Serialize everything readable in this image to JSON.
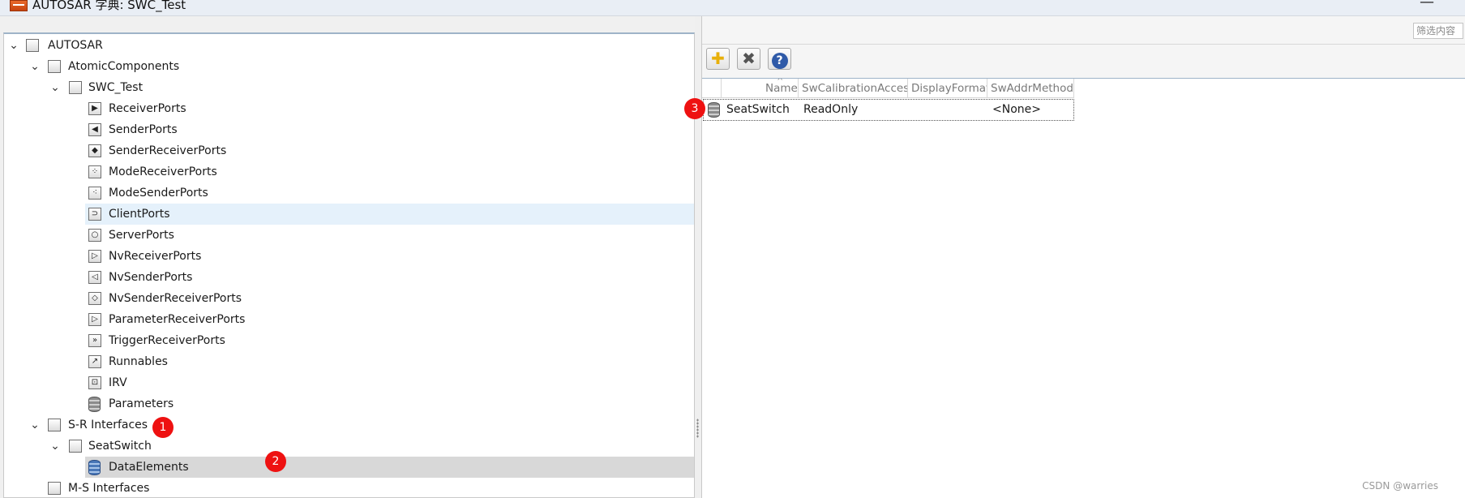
{
  "window": {
    "title": "AUTOSAR 字典: SWC_Test",
    "minimize": "—"
  },
  "tree": {
    "items": [
      {
        "label": "AUTOSAR",
        "level": 0,
        "expanded": true,
        "icon": "autosar-root-icon"
      },
      {
        "label": "AtomicComponents",
        "level": 1,
        "expanded": true,
        "icon": "components-folder-icon"
      },
      {
        "label": "SWC_Test",
        "level": 2,
        "expanded": true,
        "icon": "component-icon"
      },
      {
        "label": "ReceiverPorts",
        "level": 3,
        "icon": "receiver-port-icon",
        "glyph": "▶"
      },
      {
        "label": "SenderPorts",
        "level": 3,
        "icon": "sender-port-icon",
        "glyph": "◀"
      },
      {
        "label": "SenderReceiverPorts",
        "level": 3,
        "icon": "sender-receiver-port-icon",
        "glyph": "◆"
      },
      {
        "label": "ModeReceiverPorts",
        "level": 3,
        "icon": "mode-receiver-port-icon",
        "glyph": "⁘"
      },
      {
        "label": "ModeSenderPorts",
        "level": 3,
        "icon": "mode-sender-port-icon",
        "glyph": "⁖"
      },
      {
        "label": "ClientPorts",
        "level": 3,
        "icon": "client-port-icon",
        "glyph": "⊃",
        "selected": true
      },
      {
        "label": "ServerPorts",
        "level": 3,
        "icon": "server-port-icon",
        "glyph": "○"
      },
      {
        "label": "NvReceiverPorts",
        "level": 3,
        "icon": "nv-receiver-port-icon",
        "glyph": "▷"
      },
      {
        "label": "NvSenderPorts",
        "level": 3,
        "icon": "nv-sender-port-icon",
        "glyph": "◁"
      },
      {
        "label": "NvSenderReceiverPorts",
        "level": 3,
        "icon": "nv-sender-receiver-port-icon",
        "glyph": "◇"
      },
      {
        "label": "ParameterReceiverPorts",
        "level": 3,
        "icon": "parameter-receiver-port-icon",
        "glyph": "▷"
      },
      {
        "label": "TriggerReceiverPorts",
        "level": 3,
        "icon": "trigger-receiver-port-icon",
        "glyph": "»"
      },
      {
        "label": "Runnables",
        "level": 3,
        "icon": "runnable-icon",
        "glyph": "↗"
      },
      {
        "label": "IRV",
        "level": 3,
        "icon": "irv-icon",
        "glyph": "⊡"
      },
      {
        "label": "Parameters",
        "level": 3,
        "icon": "parameters-database-icon",
        "glyph": "db"
      },
      {
        "label": "S-R Interfaces",
        "level": 1,
        "expanded": true,
        "icon": "sr-interfaces-icon"
      },
      {
        "label": "SeatSwitch",
        "level": 2,
        "expanded": true,
        "icon": "interface-icon"
      },
      {
        "label": "DataElements",
        "level": 3,
        "icon": "data-elements-database-icon",
        "glyph": "dbblue",
        "active": true
      },
      {
        "label": "M-S Interfaces",
        "level": 1,
        "icon": "ms-interfaces-icon"
      }
    ]
  },
  "right": {
    "filter_placeholder": "筛选内容",
    "toolbar": {
      "add": "add-icon",
      "delete": "delete-icon",
      "help": "help-icon",
      "help_glyph": "?"
    },
    "table": {
      "columns": [
        "Name",
        "SwCalibrationAccess",
        "DisplayFormat",
        "SwAddrMethod"
      ],
      "sort_column": "Name",
      "sort_direction": "ascending",
      "rows": [
        {
          "name": "SeatSwitch",
          "calibration": "ReadOnly",
          "display_format": "",
          "addr_method": "<None>"
        }
      ]
    }
  },
  "annotations": [
    "1",
    "2",
    "3"
  ],
  "watermark": "CSDN @warries",
  "colors": {
    "selected_row": "#e5f1fb",
    "active_row": "#d8d8d8",
    "badge": "#ee1111"
  }
}
